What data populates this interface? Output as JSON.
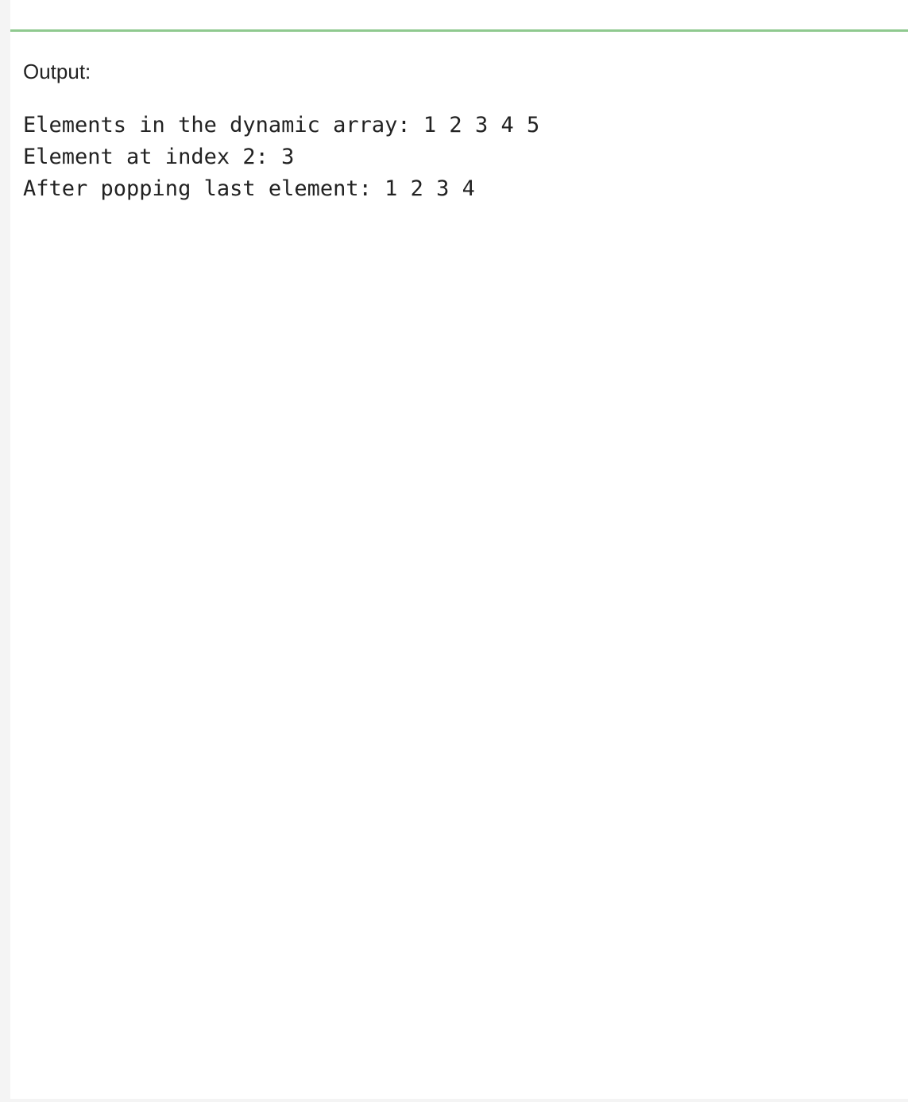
{
  "output_section": {
    "label": "Output:",
    "lines": [
      "Elements in the dynamic array: 1 2 3 4 5",
      "Element at index 2: 3",
      "After popping last element: 1 2 3 4"
    ]
  },
  "colors": {
    "divider": "#8fc98f",
    "background": "#f4f4f4",
    "panel": "#ffffff",
    "text": "#222222"
  }
}
